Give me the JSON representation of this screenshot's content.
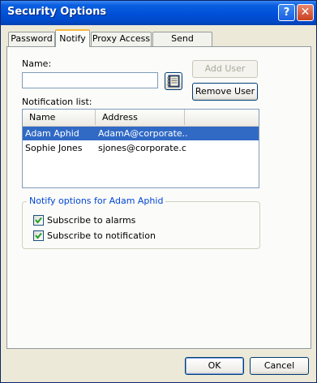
{
  "window": {
    "title": "Security Options"
  },
  "tabs": [
    {
      "label": "Password"
    },
    {
      "label": "Notify"
    },
    {
      "label": "Proxy Access"
    },
    {
      "label": "Send Options"
    }
  ],
  "name_field": {
    "label": "Name:",
    "value": ""
  },
  "buttons": {
    "add_user": "Add User",
    "remove_user": "Remove User",
    "ok": "OK",
    "cancel": "Cancel"
  },
  "notification_list": {
    "label": "Notification list:",
    "columns": [
      "Name",
      "Address"
    ],
    "rows": [
      {
        "name": "Adam Aphid",
        "address": "AdamA@corporate....",
        "selected": true
      },
      {
        "name": "Sophie Jones",
        "address": "sjones@corporate.c...",
        "selected": false
      }
    ]
  },
  "notify_options": {
    "legend": "Notify options for Adam Aphid",
    "subscribe_alarms": {
      "label": "Subscribe to alarms",
      "checked": true
    },
    "subscribe_notification": {
      "label": "Subscribe to notification",
      "checked": true
    }
  },
  "icons": {
    "help": "question-icon",
    "close": "close-icon",
    "address_book": "address-book-icon"
  },
  "colors": {
    "titlebar": "#0050d8",
    "selection": "#316ac5",
    "group_legend": "#0046d5",
    "active_tab_accent": "#f7b73f"
  }
}
